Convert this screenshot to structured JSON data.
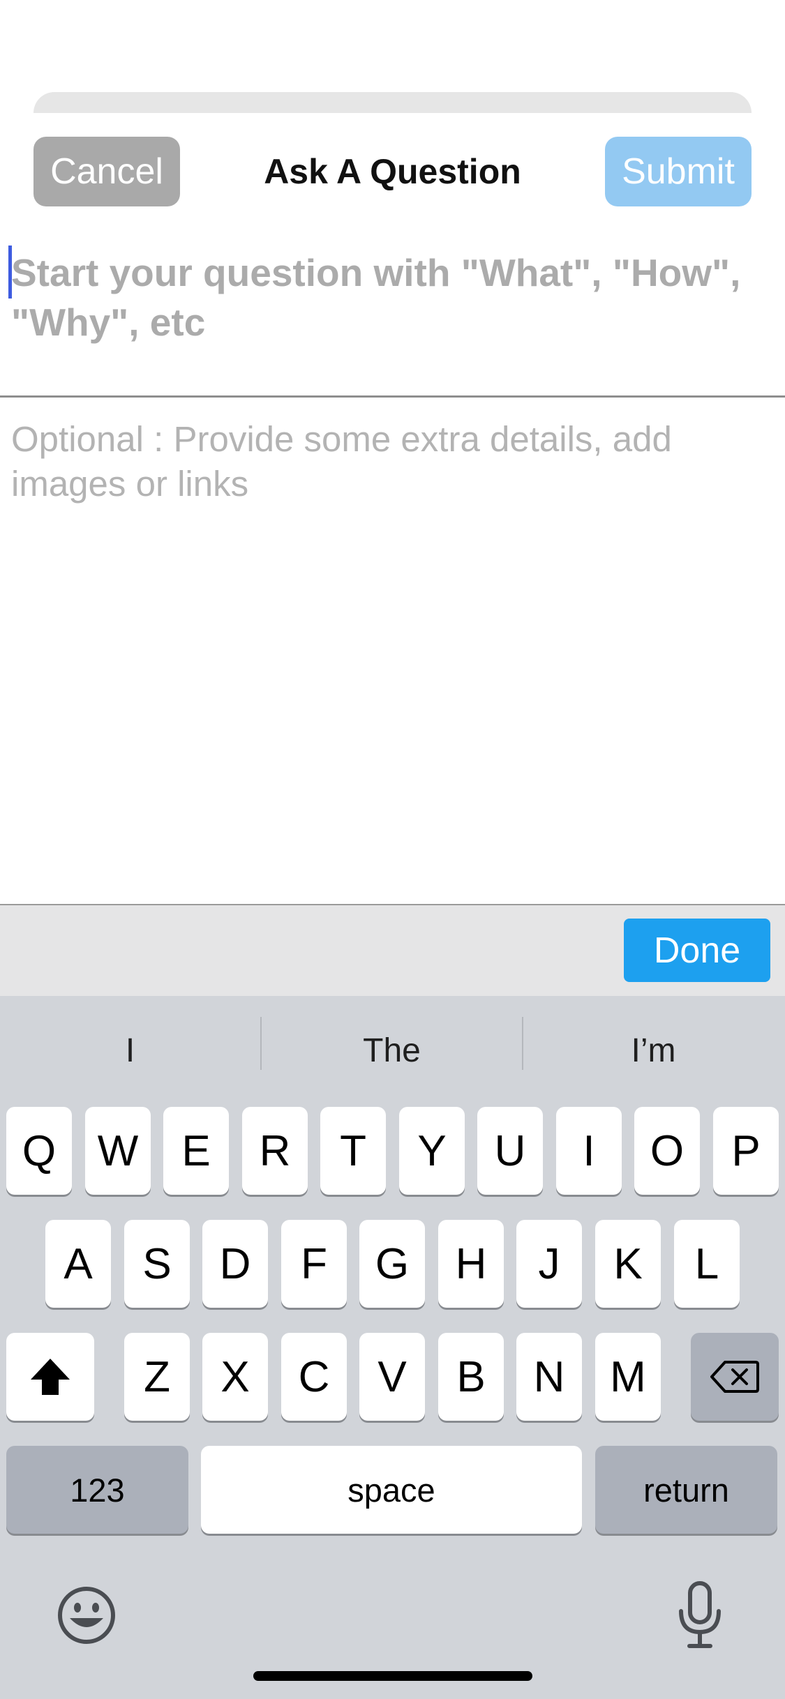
{
  "header": {
    "cancel_label": "Cancel",
    "title": "Ask A Question",
    "submit_label": "Submit"
  },
  "question_input": {
    "placeholder": "Start your question with \"What\", \"How\", \"Why\", etc",
    "value": ""
  },
  "details_input": {
    "placeholder": "Optional : Provide some extra details, add images or links",
    "value": ""
  },
  "toolbar": {
    "done_label": "Done"
  },
  "keyboard": {
    "suggestions": [
      "I",
      "The",
      "I’m"
    ],
    "row1": [
      "Q",
      "W",
      "E",
      "R",
      "T",
      "Y",
      "U",
      "I",
      "O",
      "P"
    ],
    "row2": [
      "A",
      "S",
      "D",
      "F",
      "G",
      "H",
      "J",
      "K",
      "L"
    ],
    "row3": [
      "Z",
      "X",
      "C",
      "V",
      "B",
      "N",
      "M"
    ],
    "numbers_label": "123",
    "space_label": "space",
    "return_label": "return",
    "shift_icon": "shift-icon",
    "delete_icon": "delete-icon",
    "emoji_icon": "emoji-icon",
    "mic_icon": "microphone-icon"
  },
  "colors": {
    "cancel_bg": "#a9a9a9",
    "submit_bg": "#93c9f2",
    "done_bg": "#1da0ef",
    "caret": "#3d5be0",
    "keyboard_bg": "#d1d4d9"
  }
}
